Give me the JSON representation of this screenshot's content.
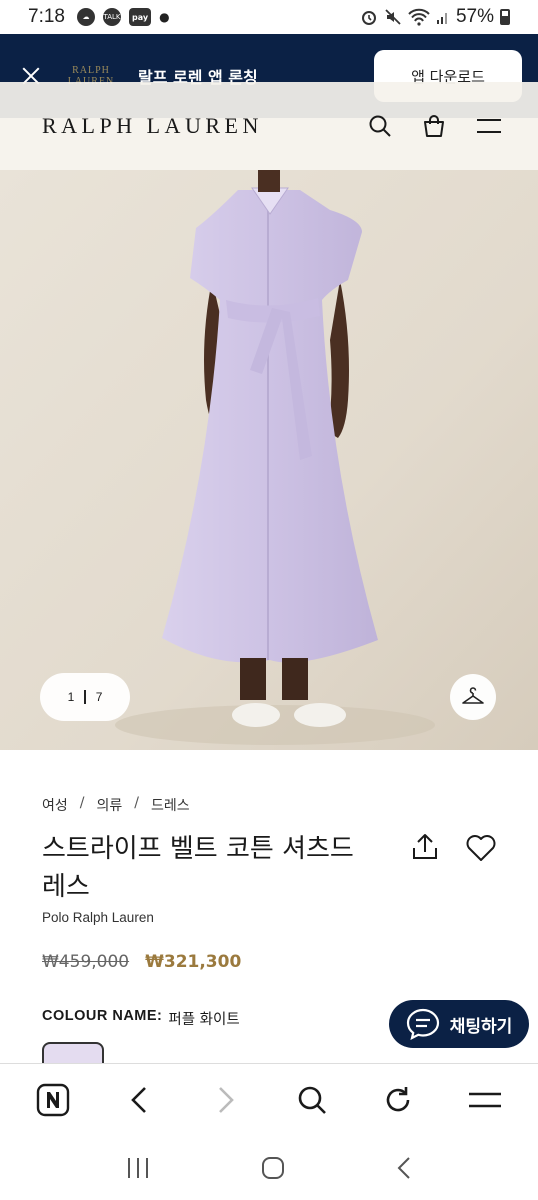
{
  "status_bar": {
    "time": "7:18",
    "badges": [
      "TALK",
      "pay"
    ],
    "battery": "57%"
  },
  "app_banner": {
    "logo_line1": "RALPH",
    "logo_line2": "LAUREN",
    "text": "랄프 로렌 앱 론칭",
    "download_label": "앱 다운로드"
  },
  "header": {
    "brand": "RALPH LAUREN"
  },
  "hero": {
    "pager_current": "1",
    "pager_total": "7"
  },
  "breadcrumb": [
    "여성",
    "의류",
    "드레스"
  ],
  "product": {
    "title": "스트라이프 벨트 코튼 셔츠드레스",
    "brand_line": "Polo Ralph Lauren",
    "price_original": "₩459,000",
    "price_sale": "₩321,300",
    "colour_label": "COLOUR NAME:",
    "colour_value": "퍼플 화이트"
  },
  "chat": {
    "label": "채팅하기"
  },
  "colors": {
    "navy": "#0b2145",
    "gold": "#9b7a3e",
    "dress": "#cfc4e6"
  }
}
